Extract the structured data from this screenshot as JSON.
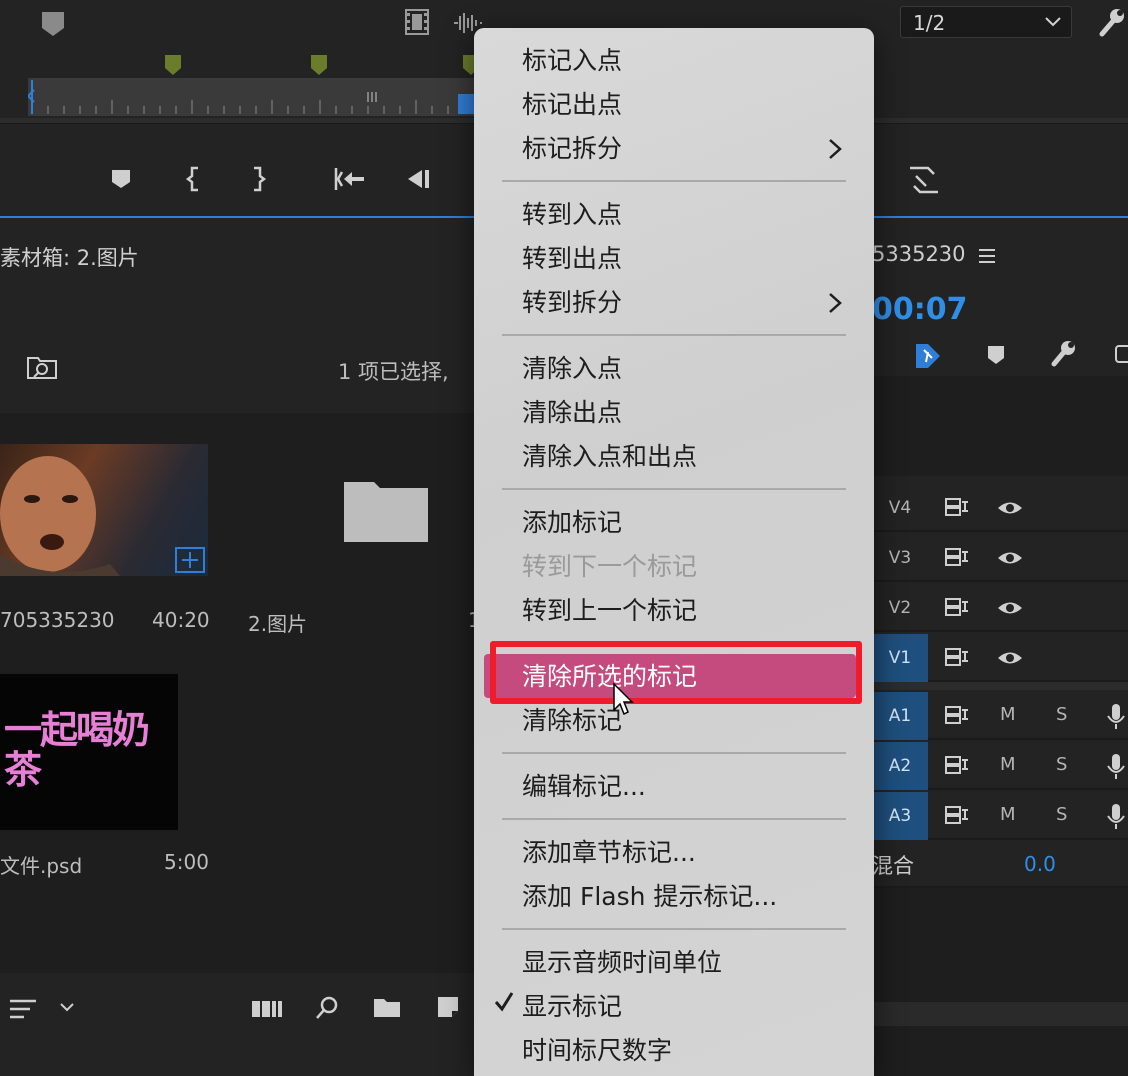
{
  "toolbar": {
    "zoom_value": "1/2"
  },
  "project_panel": {
    "title": "素材箱: 2.图片",
    "selection_status": "1 项已选择,",
    "items": [
      {
        "name": "705335230",
        "duration": "40:20"
      },
      {
        "name": "2.图片",
        "duration": "1"
      },
      {
        "name": "文件.psd",
        "duration": "5:00"
      }
    ],
    "psd_thumb_text": "一起喝奶茶"
  },
  "timeline_panel": {
    "sequence_name": "5335230",
    "timecode": "00:07",
    "tracks": [
      {
        "label": "V4",
        "type": "video",
        "targeted": false
      },
      {
        "label": "V3",
        "type": "video",
        "targeted": false
      },
      {
        "label": "V2",
        "type": "video",
        "targeted": false
      },
      {
        "label": "V1",
        "type": "video",
        "targeted": true
      },
      {
        "label": "A1",
        "type": "audio",
        "targeted": true,
        "mute": "M",
        "solo": "S"
      },
      {
        "label": "A2",
        "type": "audio",
        "targeted": true,
        "mute": "M",
        "solo": "S"
      },
      {
        "label": "A3",
        "type": "audio",
        "targeted": true,
        "mute": "M",
        "solo": "S"
      }
    ],
    "mix_label": "混合",
    "mix_value": "0.0"
  },
  "context_menu": {
    "groups": [
      [
        {
          "label": "标记入点"
        },
        {
          "label": "标记出点"
        },
        {
          "label": "标记拆分",
          "submenu": true
        }
      ],
      [
        {
          "label": "转到入点"
        },
        {
          "label": "转到出点"
        },
        {
          "label": "转到拆分",
          "submenu": true
        }
      ],
      [
        {
          "label": "清除入点"
        },
        {
          "label": "清除出点"
        },
        {
          "label": "清除入点和出点"
        }
      ],
      [
        {
          "label": "添加标记"
        },
        {
          "label": "转到下一个标记",
          "disabled": true
        },
        {
          "label": "转到上一个标记"
        }
      ],
      [
        {
          "label": "清除所选的标记",
          "highlighted": true
        },
        {
          "label": "清除标记"
        }
      ],
      [
        {
          "label": "编辑标记..."
        }
      ],
      [
        {
          "label": "添加章节标记..."
        },
        {
          "label": "添加 Flash 提示标记..."
        }
      ],
      [
        {
          "label": "显示音频时间单位"
        },
        {
          "label": "显示标记",
          "checked": true
        },
        {
          "label": "时间标尺数字"
        }
      ]
    ]
  },
  "colors": {
    "accent_blue": "#2f7fd8",
    "highlight_pink": "#c54b7e",
    "annotation_red": "#ef1c2b",
    "marker_green": "#6b7d2a"
  }
}
